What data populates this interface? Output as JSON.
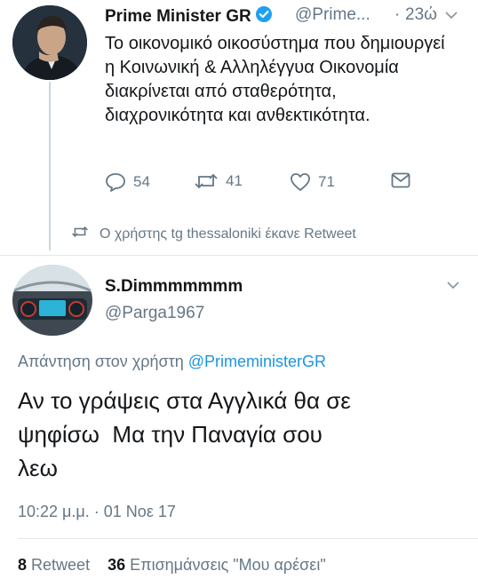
{
  "tweet1": {
    "author_name": "Prime Minister GR",
    "handle": "@Prime...",
    "separator": "·",
    "time": "23ώ",
    "text": "Το οικονομικό οικοσύστημα που δημιουργεί η Κοινωνική & Αλληλέγγυα Οικονομία διακρίνεται από σταθερότητα, διαχρονικότητα και ανθεκτικότητα.",
    "replies": "54",
    "retweets": "41",
    "likes": "71",
    "icons": [
      "verified-badge-icon",
      "chevron-down-icon",
      "reply-icon",
      "retweet-icon",
      "heart-icon",
      "direct-message-icon"
    ]
  },
  "retweet_context": {
    "text": "Ο χρήστης tg thessaloniki έκανε Retweet",
    "icon": "retweet-icon"
  },
  "tweet2": {
    "author_name": "S.Dimmmmmmm",
    "handle": "@Parga1967",
    "reply_prefix": "Απάντηση στον χρήστη",
    "reply_mention": "@PrimeministerGR",
    "text_lines": [
      "Αν το γράψεις στα Αγγλικά θα σε",
      "ψηφίσω  Μα την Παναγία σου",
      "λεω"
    ],
    "timestamp": "10:22 μ.μ. · 01 Νοε 17",
    "stats": {
      "retweet_count": "8",
      "retweet_label": "Retweet",
      "likes_count": "36",
      "likes_label": "Επισημάνσεις \"Μου αρέσει\""
    }
  },
  "colors": {
    "text": "#14171a",
    "secondary": "#657786",
    "link": "#1b95e0",
    "verified": "#1da1f2",
    "divider": "#e1e8ed"
  }
}
